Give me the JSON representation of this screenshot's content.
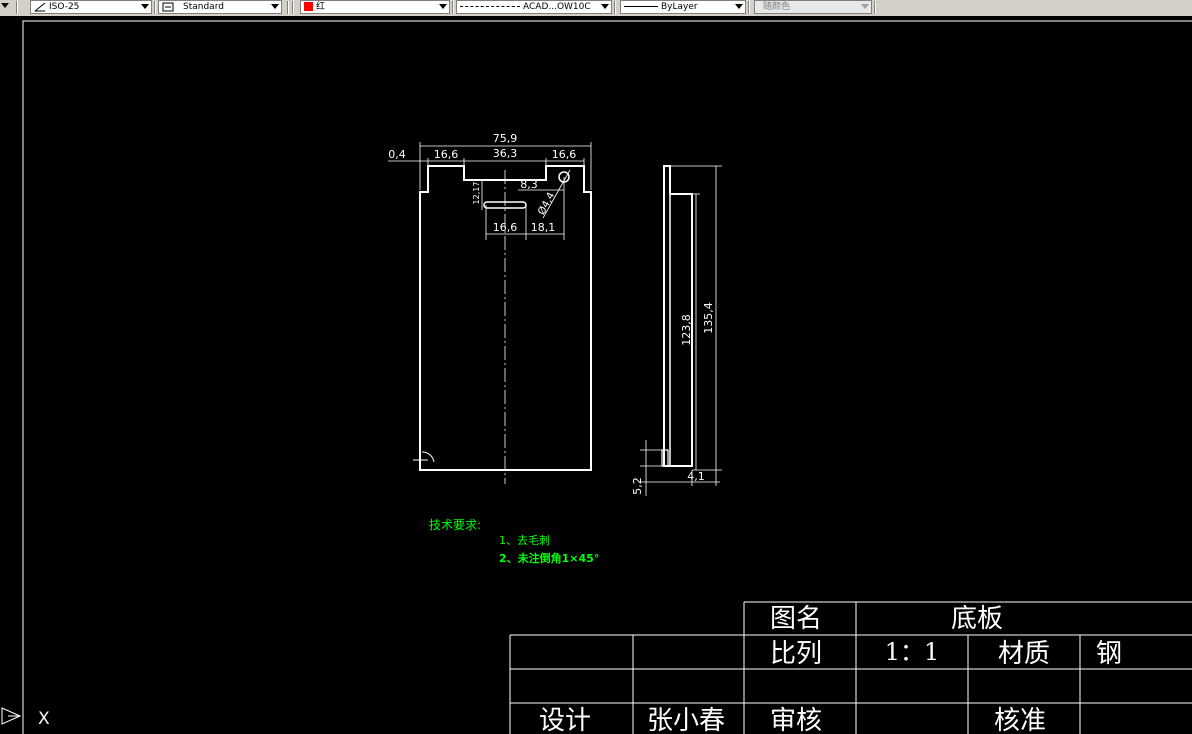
{
  "toolbar": {
    "dimstyle": "ISO-25",
    "textstyle": "Standard",
    "color": "红",
    "linetype": "ACAD...OW10C",
    "lineweight": "ByLayer",
    "plotstyle": "随颜色",
    "color_swatch": "#ff0000"
  },
  "dims": {
    "overall_width": "75,9",
    "offset_left": "0,4",
    "tab_left": "16,6",
    "notch_width": "36,3",
    "tab_right": "16,6",
    "hole_offset": "8,3",
    "slot_height": "12,17",
    "hole_diameter": "Ø4,4",
    "slot_width": "16,6",
    "slot_to_hole": "18,1",
    "inner_height": "123,8",
    "overall_height": "135,4",
    "flange": "5,2",
    "thickness": "4,1"
  },
  "notes": {
    "heading": "技术要求:",
    "item1": "1、去毛刺",
    "item2": "2、未注倒角1×45°"
  },
  "titleblock": {
    "name_label": "图名",
    "name_value": "底板",
    "scale_label": "比列",
    "scale_value": "1：1",
    "material_label": "材质",
    "material_value": "钢",
    "designer_label": "设计",
    "designer_value": "张小春",
    "review_label": "审核",
    "approve_label": "核准"
  },
  "ucs": {
    "x_label": "X"
  },
  "colors": {
    "background": "#000000",
    "geometry": "#ffffff",
    "notes": "#00ff00"
  }
}
